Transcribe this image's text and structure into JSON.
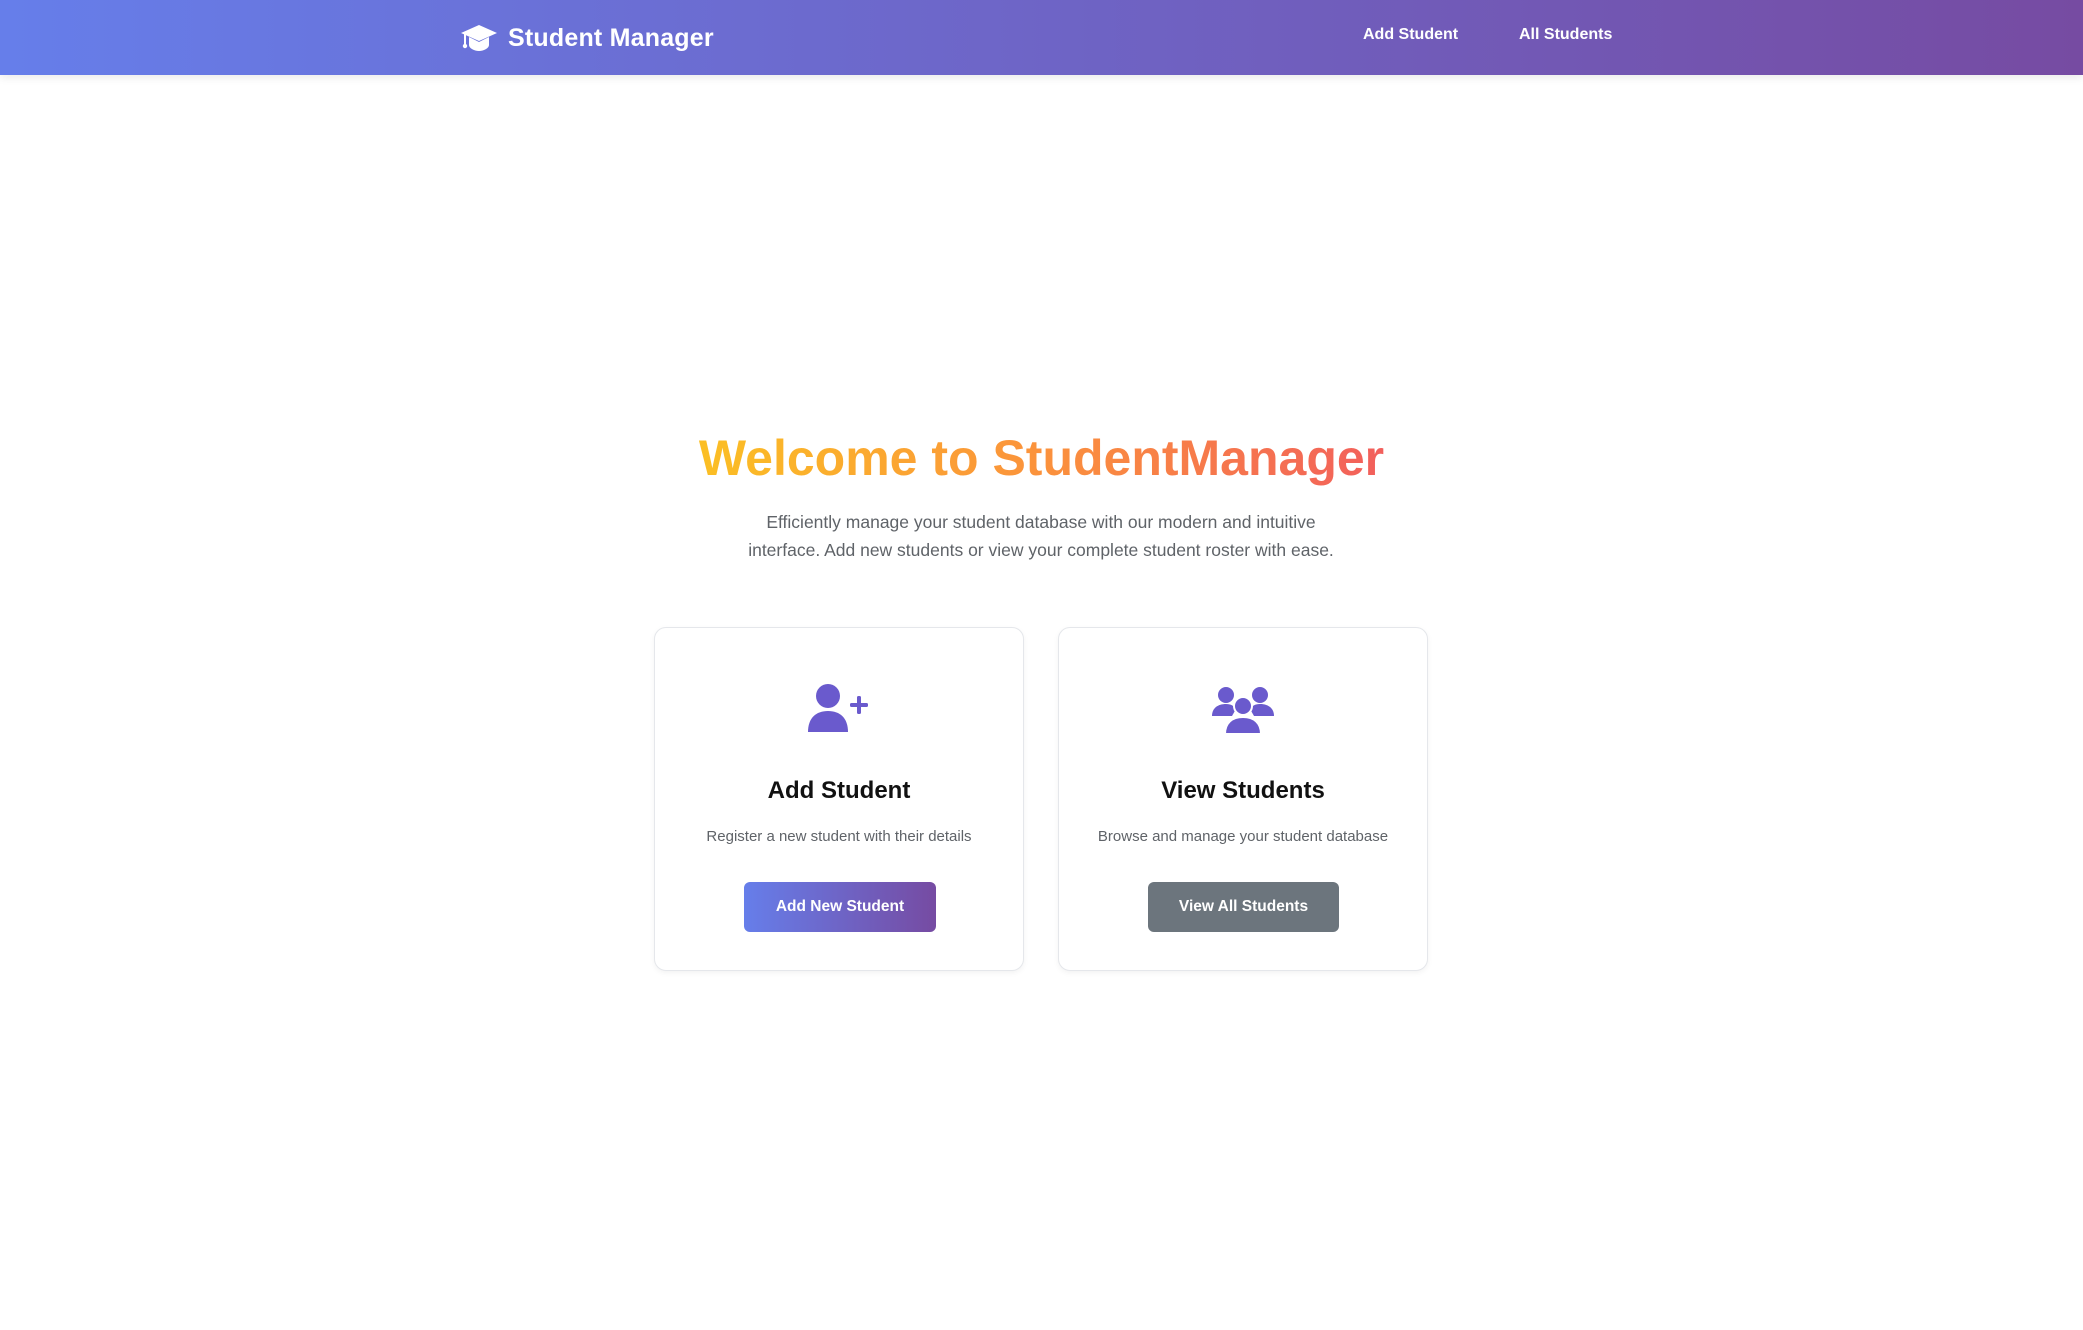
{
  "navbar": {
    "brand": "Student Manager",
    "brand_icon": "graduation-cap-icon",
    "links": [
      {
        "label": "Add Student"
      },
      {
        "label": "All Students"
      }
    ]
  },
  "hero": {
    "title": "Welcome to StudentManager",
    "subtitle": "Efficiently manage your student database with our modern and intuitive interface. Add new students or view your complete student roster with ease."
  },
  "cards": [
    {
      "icon": "user-plus-icon",
      "title": "Add Student",
      "description": "Register a new student with their details",
      "button": "Add New Student"
    },
    {
      "icon": "users-icon",
      "title": "View Students",
      "description": "Browse and manage your student database",
      "button": "View All Students"
    }
  ],
  "colors": {
    "gradient_start": "#667eea",
    "gradient_end": "#764ba2",
    "icon_color": "#6a5acd",
    "secondary_button": "#6c757d",
    "title_gradient": [
      "#fbbf24",
      "#fb923c",
      "#f25f5c"
    ]
  }
}
